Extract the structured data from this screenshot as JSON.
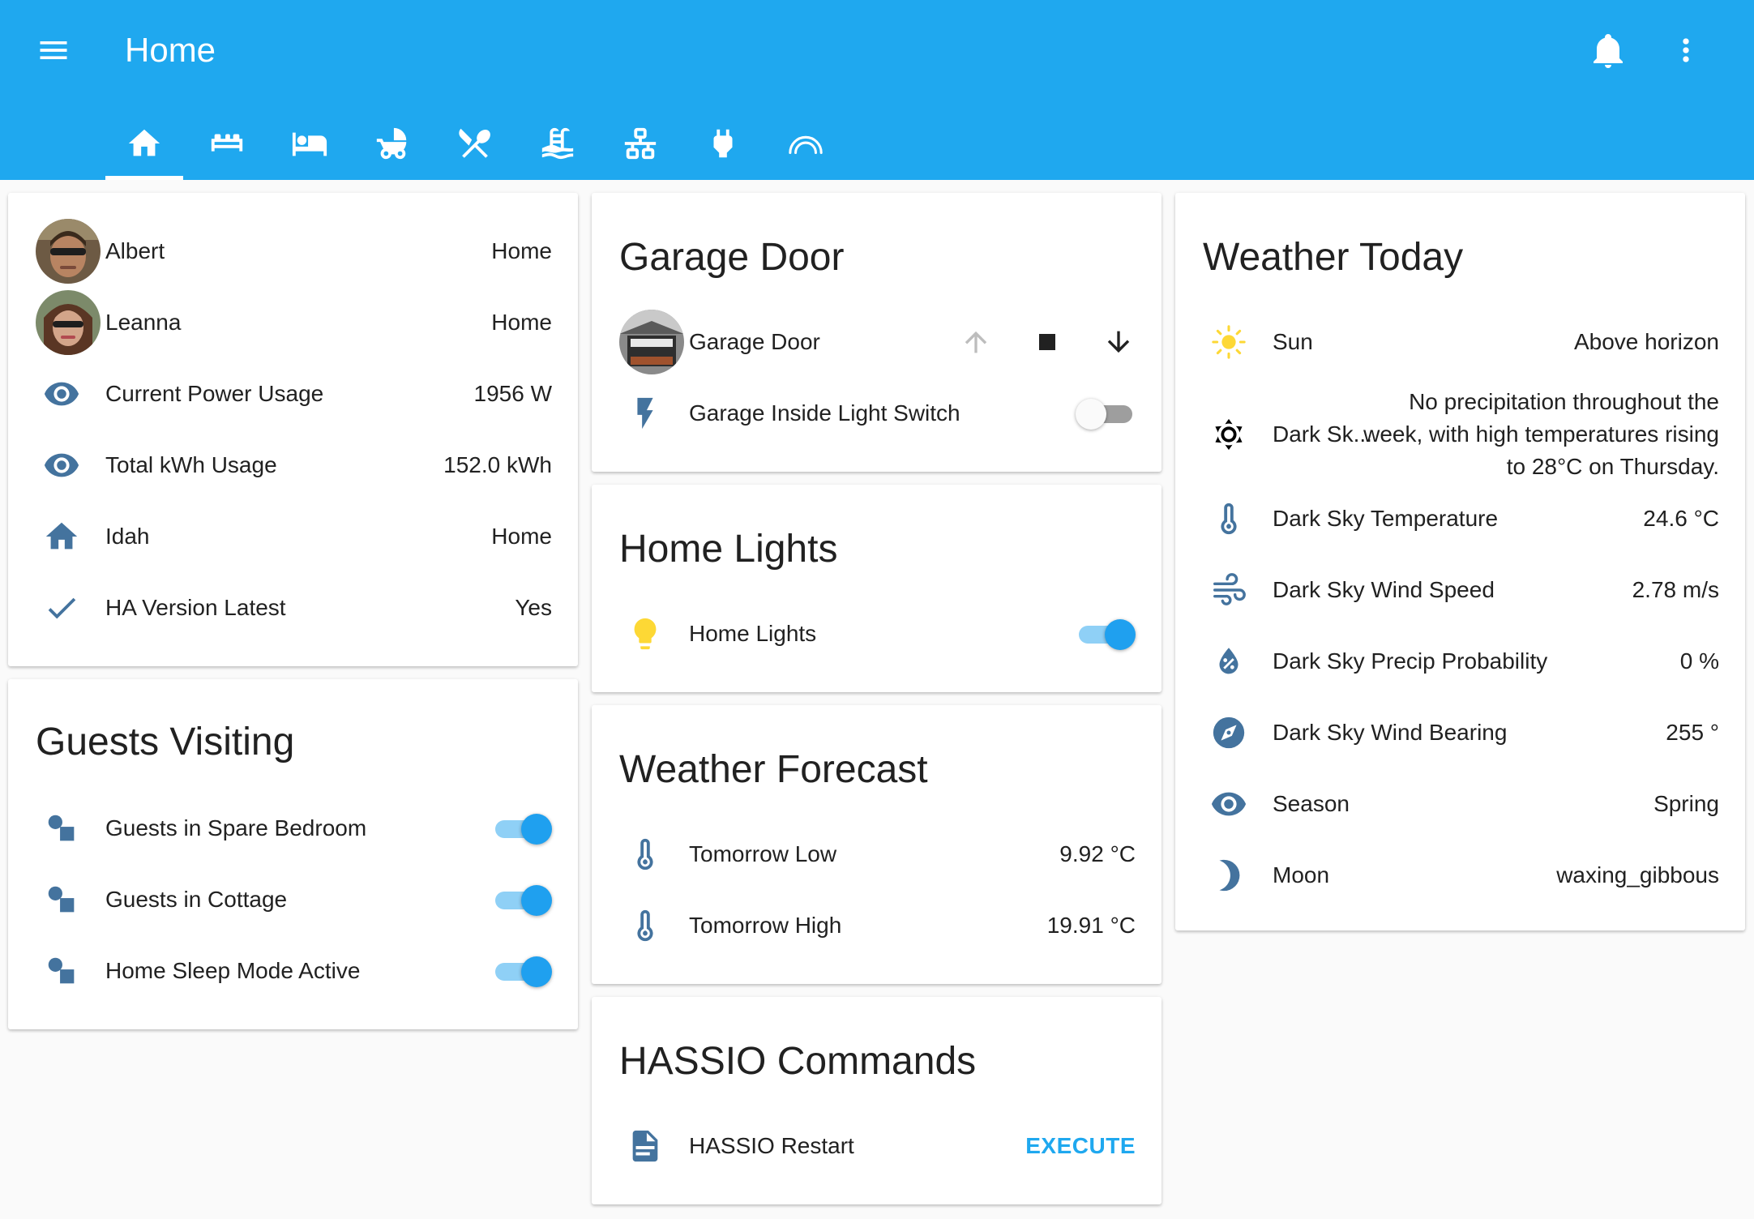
{
  "header": {
    "title": "Home",
    "tabs": [
      {
        "icon": "home-icon",
        "active": true
      },
      {
        "icon": "sofa-icon"
      },
      {
        "icon": "bed-icon"
      },
      {
        "icon": "stroller-icon"
      },
      {
        "icon": "silverware-icon"
      },
      {
        "icon": "pool-icon"
      },
      {
        "icon": "lan-icon"
      },
      {
        "icon": "power-plug-icon"
      },
      {
        "icon": "rainbow-icon"
      }
    ]
  },
  "status_card": {
    "rows": [
      {
        "label": "Albert",
        "value": "Home",
        "icon": "avatar-albert"
      },
      {
        "label": "Leanna",
        "value": "Home",
        "icon": "avatar-leanna"
      },
      {
        "label": "Current Power Usage",
        "value": "1956 W",
        "icon": "eye-icon"
      },
      {
        "label": "Total kWh Usage",
        "value": "152.0 kWh",
        "icon": "eye-icon"
      },
      {
        "label": "Idah",
        "value": "Home",
        "icon": "home-icon"
      },
      {
        "label": "HA Version Latest",
        "value": "Yes",
        "icon": "check-icon"
      }
    ]
  },
  "guests_card": {
    "title": "Guests Visiting",
    "rows": [
      {
        "label": "Guests in Spare Bedroom",
        "state": "on"
      },
      {
        "label": "Guests in Cottage",
        "state": "on"
      },
      {
        "label": "Home Sleep Mode Active",
        "state": "on"
      }
    ]
  },
  "garage_card": {
    "title": "Garage Door",
    "cover_label": "Garage Door",
    "switch_label": "Garage Inside Light Switch",
    "switch_state": "off"
  },
  "lights_card": {
    "title": "Home Lights",
    "label": "Home Lights",
    "state": "on"
  },
  "forecast_card": {
    "title": "Weather Forecast",
    "rows": [
      {
        "label": "Tomorrow Low",
        "value": "9.92 °C"
      },
      {
        "label": "Tomorrow High",
        "value": "19.91 °C"
      }
    ]
  },
  "hassio_card": {
    "title": "HASSIO Commands",
    "label": "HASSIO Restart",
    "action": "EXECUTE"
  },
  "weather_card": {
    "title": "Weather Today",
    "sun": {
      "label": "Sun",
      "value": "Above horizon"
    },
    "summary": {
      "label": "Dark Sk...",
      "value": "No precipitation throughout the week, with high temperatures rising to 28°C on Thursday."
    },
    "rows": [
      {
        "label": "Dark Sky Temperature",
        "value": "24.6 °C",
        "icon": "thermometer-icon"
      },
      {
        "label": "Dark Sky Wind Speed",
        "value": "2.78 m/s",
        "icon": "wind-icon"
      },
      {
        "label": "Dark Sky Precip Probability",
        "value": "0 %",
        "icon": "water-percent-icon"
      },
      {
        "label": "Dark Sky Wind Bearing",
        "value": "255 °",
        "icon": "compass-icon"
      },
      {
        "label": "Season",
        "value": "Spring",
        "icon": "eye-icon"
      },
      {
        "label": "Moon",
        "value": "waxing_gibbous",
        "icon": "moon-icon"
      }
    ]
  },
  "colors": {
    "primary": "#1fa8ef",
    "icon": "#44739e",
    "bulb_on": "#fdd835",
    "sun": "#fdd835"
  }
}
